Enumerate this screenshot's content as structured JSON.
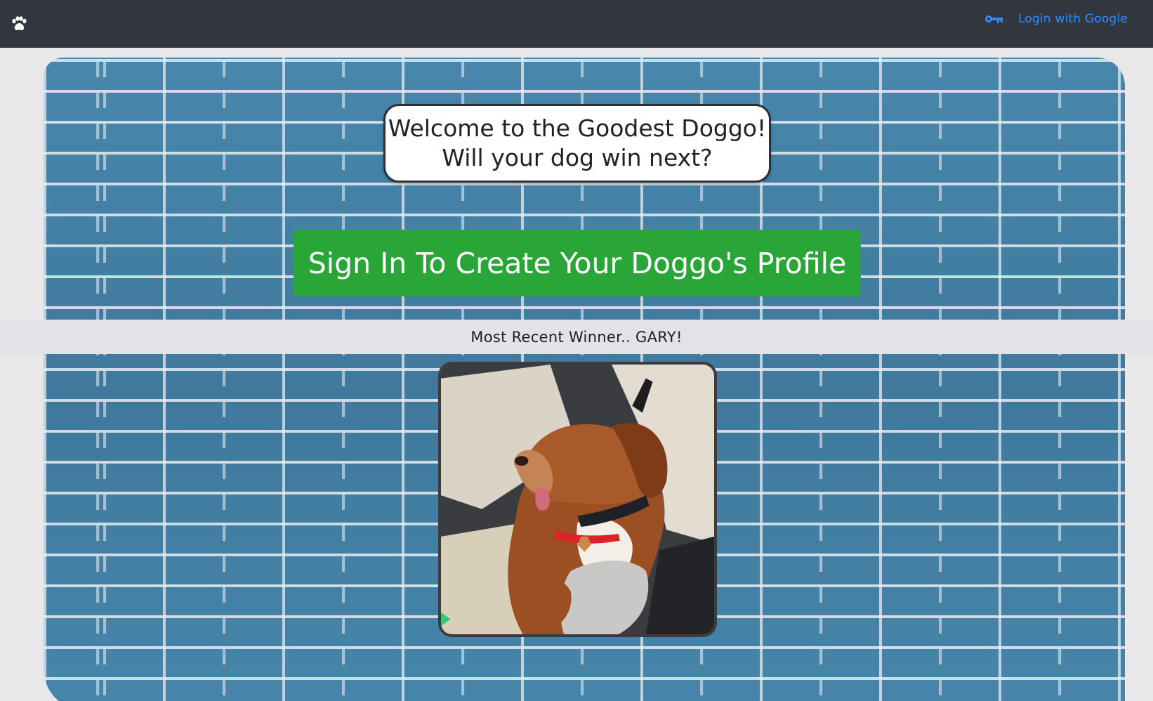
{
  "navbar": {
    "brand_icon": "paw-icon",
    "login_icon": "key-icon",
    "login_label": "Login with Google",
    "login_color": "#2d8cff",
    "background": "#31363f"
  },
  "hero": {
    "welcome_line1": "Welcome to the Goodest Doggo!",
    "welcome_line2": "Will your dog win next?",
    "cta_label": "Sign In To Create Your Doggo's Profile",
    "cta_color": "#2aa639"
  },
  "winner": {
    "label": "Most Recent Winner.. GARY!",
    "photo_icon": "dog-photo"
  }
}
